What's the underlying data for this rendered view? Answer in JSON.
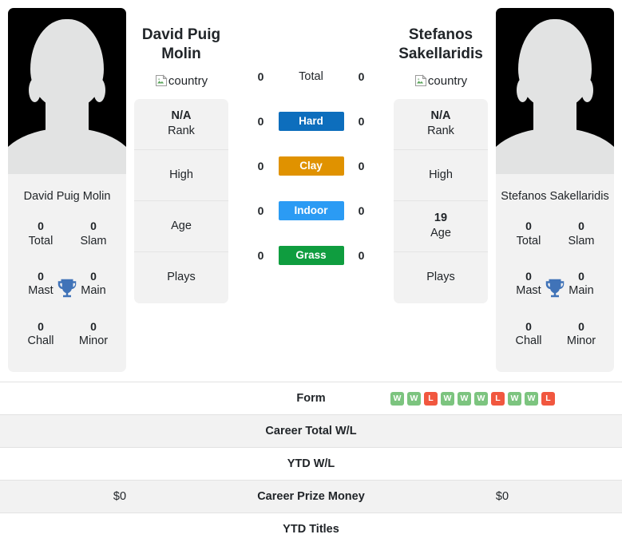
{
  "players": {
    "left": {
      "name": "David Puig Molin",
      "name_short": "David Puig Molin",
      "country_alt": "country",
      "rank": "N/A",
      "rank_label": "Rank",
      "high_value": "",
      "high_label": "High",
      "age_value": "",
      "age_label": "Age",
      "plays_value": "",
      "plays_label": "Plays",
      "titles": {
        "total": "0",
        "total_label": "Total",
        "slam": "0",
        "slam_label": "Slam",
        "mast": "0",
        "mast_label": "Mast",
        "main": "0",
        "main_label": "Main",
        "chall": "0",
        "chall_label": "Chall",
        "minor": "0",
        "minor_label": "Minor"
      }
    },
    "right": {
      "name": "Stefanos Sakellaridis",
      "name_short": "Stefanos Sakellaridis",
      "country_alt": "country",
      "rank": "N/A",
      "rank_label": "Rank",
      "high_value": "",
      "high_label": "High",
      "age_value": "19",
      "age_label": "Age",
      "plays_value": "",
      "plays_label": "Plays",
      "titles": {
        "total": "0",
        "total_label": "Total",
        "slam": "0",
        "slam_label": "Slam",
        "mast": "0",
        "mast_label": "Mast",
        "main": "0",
        "main_label": "Main",
        "chall": "0",
        "chall_label": "Chall",
        "minor": "0",
        "minor_label": "Minor"
      }
    }
  },
  "surfaces": [
    {
      "label": "Total",
      "left": "0",
      "right": "0",
      "color": "",
      "plain": true
    },
    {
      "label": "Hard",
      "left": "0",
      "right": "0",
      "color": "#0d6ebd",
      "plain": false
    },
    {
      "label": "Clay",
      "left": "0",
      "right": "0",
      "color": "#e09200",
      "plain": false
    },
    {
      "label": "Indoor",
      "left": "0",
      "right": "0",
      "color": "#2b9bf4",
      "plain": false
    },
    {
      "label": "Grass",
      "left": "0",
      "right": "0",
      "color": "#0f9d3f",
      "plain": false
    }
  ],
  "table_rows": [
    {
      "label": "Form",
      "left": "",
      "right": "",
      "type": "form"
    },
    {
      "label": "Career Total W/L",
      "left": "",
      "right": "",
      "type": "text"
    },
    {
      "label": "YTD W/L",
      "left": "",
      "right": "",
      "type": "text"
    },
    {
      "label": "Career Prize Money",
      "left": "$0",
      "right": "$0",
      "type": "text"
    },
    {
      "label": "YTD Titles",
      "left": "",
      "right": "",
      "type": "text"
    }
  ],
  "form_right": [
    "W",
    "W",
    "L",
    "W",
    "W",
    "W",
    "L",
    "W",
    "W",
    "L"
  ],
  "form_left": [],
  "colors": {
    "win": "#7cc47f",
    "loss": "#f1573f",
    "trophy": "#4073b8",
    "card_bg": "#f2f2f2",
    "row_alt": "#f2f2f2"
  }
}
